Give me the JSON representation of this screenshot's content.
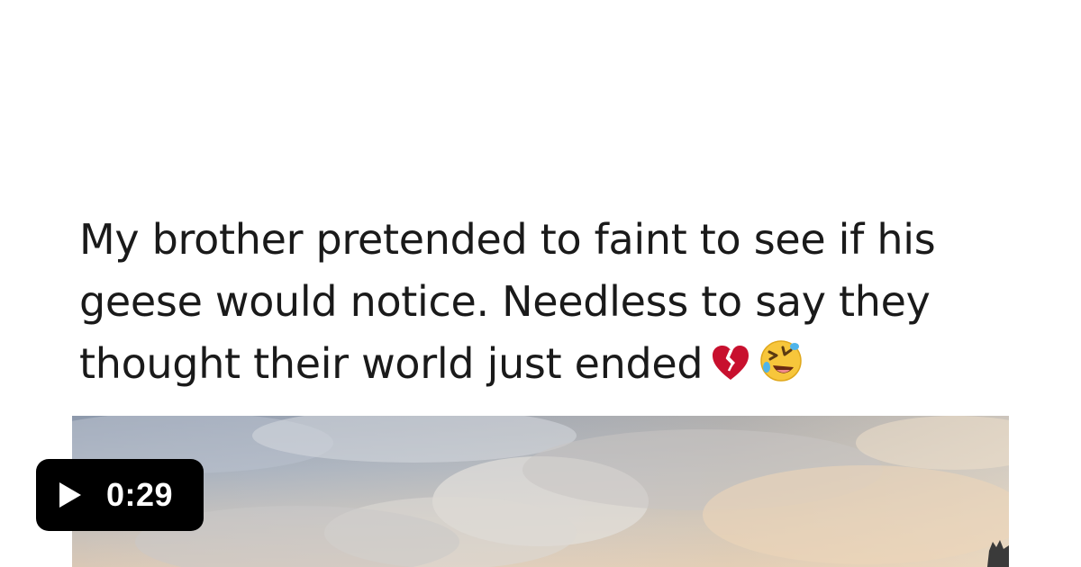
{
  "post": {
    "caption_lines": [
      "My brother pretended to faint to see if his",
      "geese would notice. Needless to say they",
      "thought their world just ended"
    ],
    "emojis": [
      "broken-heart-icon",
      "rolling-on-floor-laughing-icon"
    ]
  },
  "video": {
    "duration": "0:29"
  },
  "colors": {
    "background": "#ffffff",
    "text": "#1a1a1a",
    "badge": "#000000",
    "badge_text": "#ffffff"
  }
}
